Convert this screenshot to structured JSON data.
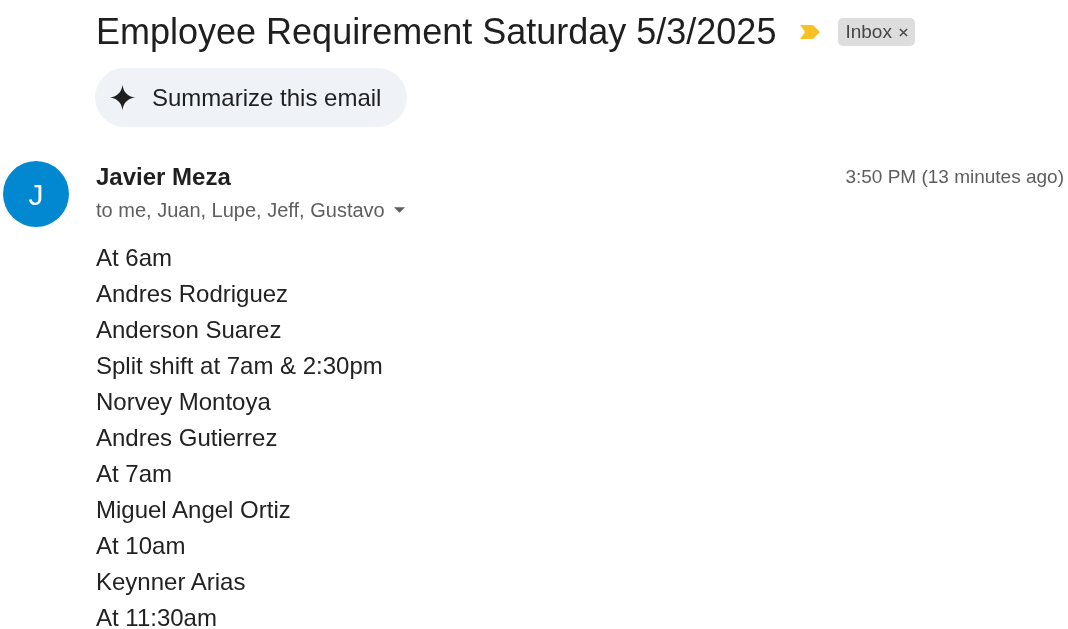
{
  "email": {
    "subject": "Employee Requirement Saturday 5/3/2025",
    "important": true,
    "labels": [
      {
        "text": "Inbox"
      }
    ],
    "summarize_button": "Summarize this email",
    "sender": {
      "initial": "J",
      "name": "Javier Meza",
      "recipients": "to me, Juan, Lupe, Jeff, Gustavo",
      "time": "3:50 PM (13 minutes ago)"
    },
    "body_lines": [
      "At 6am",
      "Andres Rodriguez",
      "Anderson Suarez",
      "Split shift at 7am & 2:30pm",
      "Norvey Montoya",
      "Andres Gutierrez",
      "At 7am",
      "Miguel Angel Ortiz",
      "At 10am",
      "Keynner Arias",
      "At 11:30am"
    ]
  }
}
